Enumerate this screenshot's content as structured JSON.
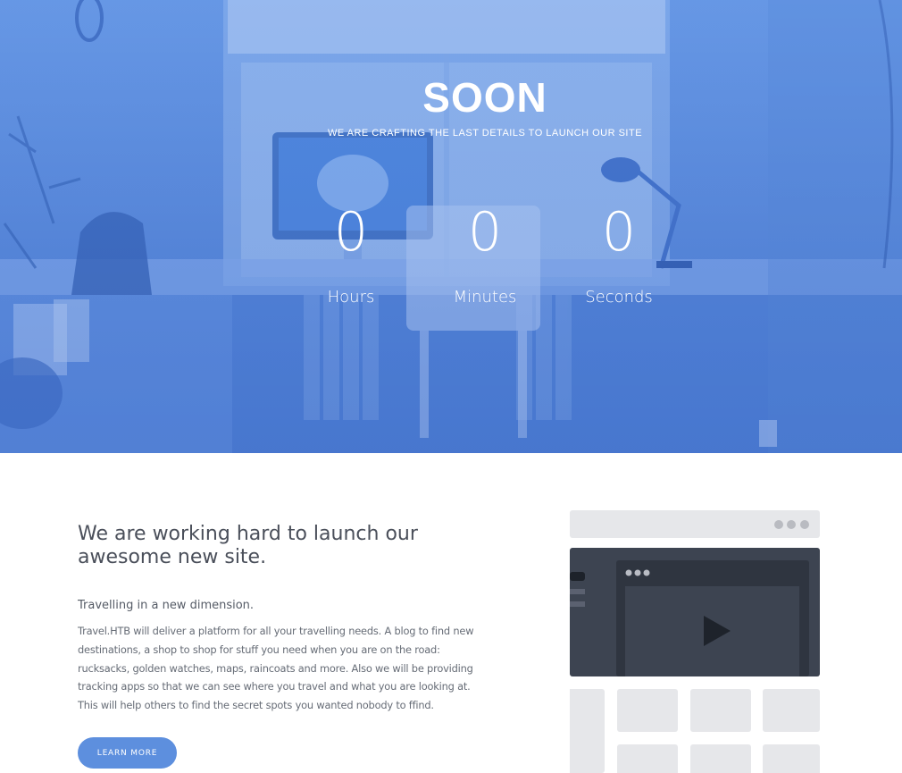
{
  "hero": {
    "title": "SOON",
    "subtitle": "WE ARE CRAFTING THE LAST DETAILS TO LAUNCH OUR SITE",
    "countdown": [
      {
        "value": "0",
        "label": "Hours"
      },
      {
        "value": "0",
        "label": "Minutes"
      },
      {
        "value": "0",
        "label": "Seconds"
      }
    ],
    "overlay_color": "#5b8fe0"
  },
  "about": {
    "headline": "We are working hard to launch our awesome new site.",
    "subheading": "Travelling in a new dimension.",
    "body": "Travel.HTB will deliver a platform for all your travelling needs. A blog to find new destinations, a shop to shop for stuff you need when you are on the road: rucksacks, golden watches, maps, raincoats and more. Also we will be providing tracking apps so that we can see where you travel and what you are looking at. This will help others to find the secret spots you wanted nobody to ffind.",
    "button_label": "LEARN MORE",
    "accent_color": "#5d8fde"
  },
  "illustration": {
    "icons": [
      "browser-window-icon",
      "play-icon"
    ]
  }
}
